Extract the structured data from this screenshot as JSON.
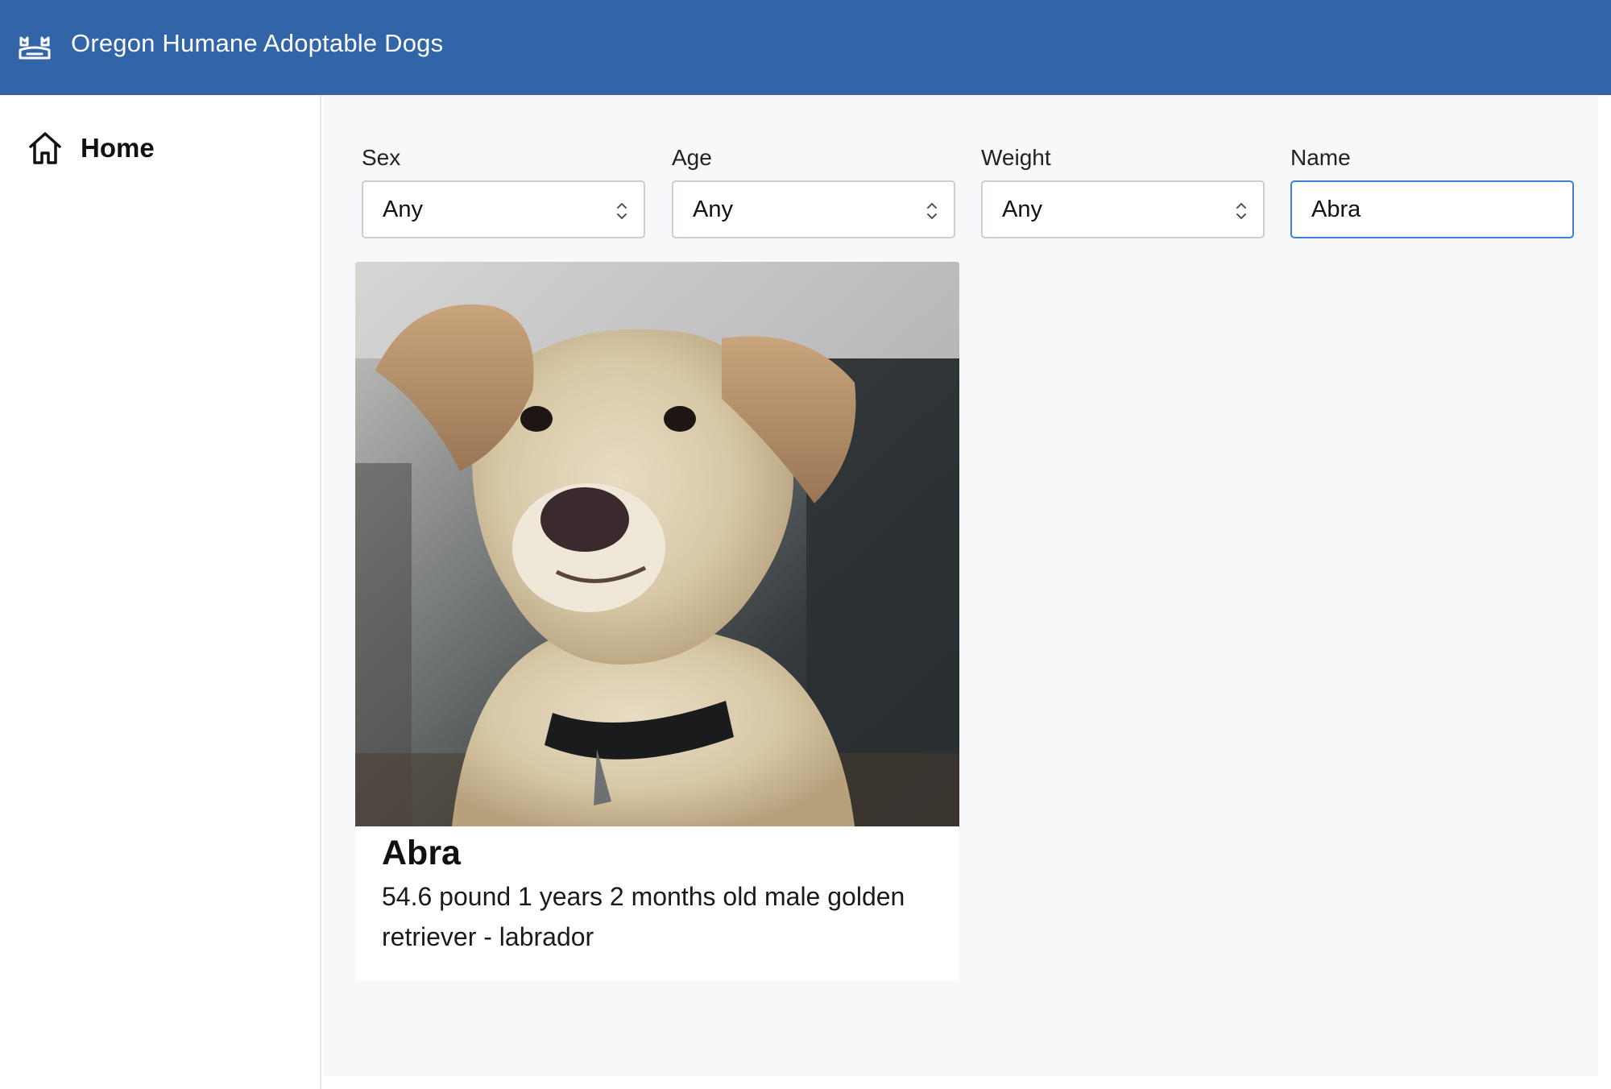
{
  "header": {
    "title": "Oregon Humane Adoptable Dogs",
    "icon": "dogs-icon",
    "background_color": "#3165a8"
  },
  "sidebar": {
    "items": [
      {
        "label": "Home",
        "icon": "home-icon"
      }
    ]
  },
  "filters": {
    "sex": {
      "label": "Sex",
      "value": "Any",
      "options": [
        "Any"
      ]
    },
    "age": {
      "label": "Age",
      "value": "Any",
      "options": [
        "Any"
      ]
    },
    "weight": {
      "label": "Weight",
      "value": "Any",
      "options": [
        "Any"
      ]
    },
    "name": {
      "label": "Name",
      "value": "Abra"
    }
  },
  "results": [
    {
      "name": "Abra",
      "description": "54.6 pound 1 years 2 months old male golden retriever - labrador",
      "photo": "dog-photo"
    }
  ]
}
